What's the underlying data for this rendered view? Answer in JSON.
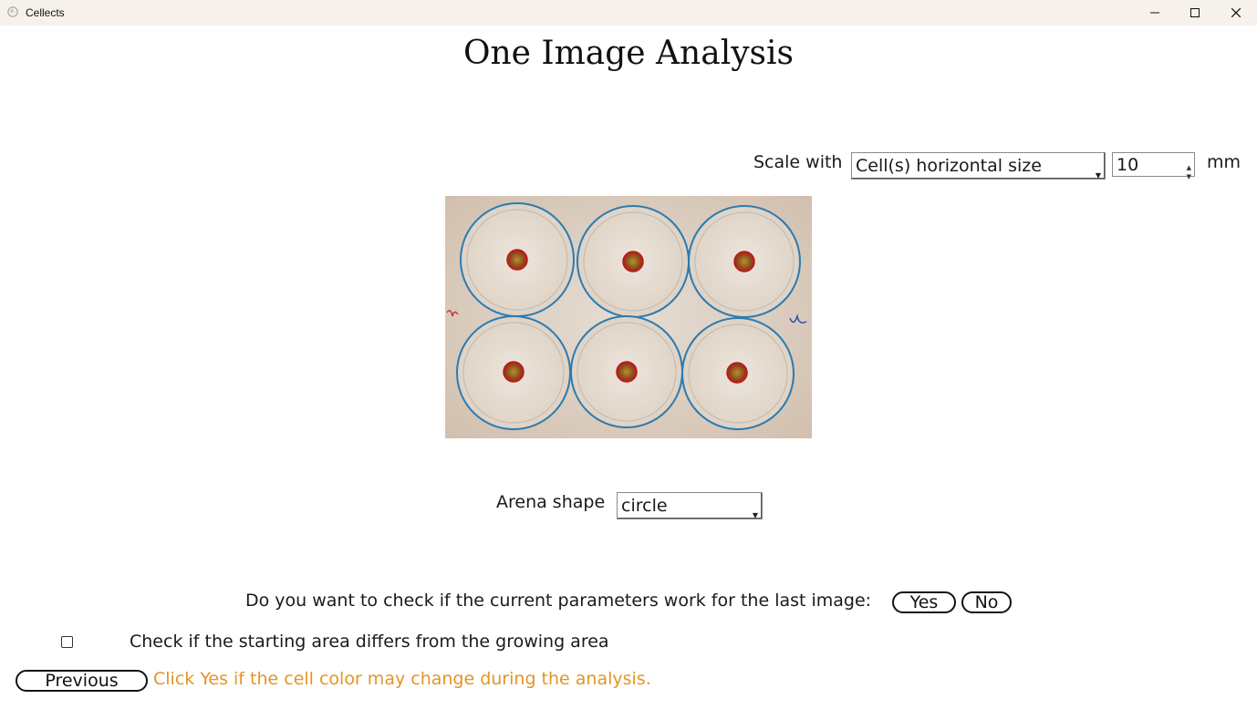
{
  "window": {
    "title": "Cellects",
    "app_icon": "cellects-app-icon",
    "controls": [
      "minimize-icon",
      "maximize-icon",
      "close-icon"
    ]
  },
  "page": {
    "title": "One Image Analysis"
  },
  "scale": {
    "label": "Scale with",
    "method": "Cell(s) horizontal size",
    "value": "10",
    "unit": "mm"
  },
  "image": {
    "description_icon": "petri-dish-image",
    "plate_count": 6
  },
  "arena": {
    "label": "Arena shape",
    "shape": "circle"
  },
  "last_image_check": {
    "question": "Do you want to check if the current parameters work for the last image:",
    "yes_label": "Yes",
    "no_label": "No"
  },
  "starting_area": {
    "checked": false,
    "label": "Check if the starting area differs from the growing area"
  },
  "footer": {
    "previous_label": "Previous",
    "hint": "Click Yes if the cell color may change during the analysis.",
    "hint_color": "#e59424"
  }
}
